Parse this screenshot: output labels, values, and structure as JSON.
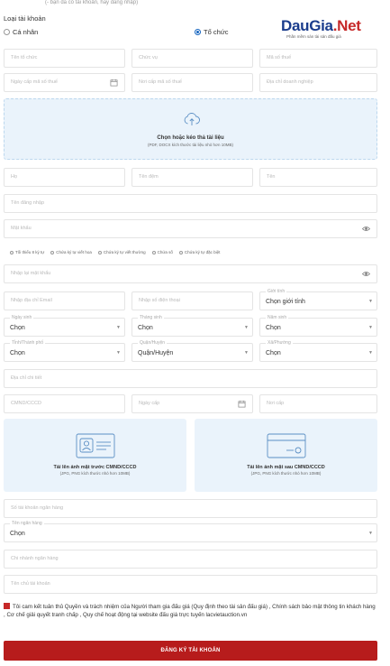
{
  "top_note": "(- bạn đã có tài khoản, hãy đăng nhập)",
  "account_type": {
    "label": "Loại tài khoản",
    "options": [
      "Cá nhân",
      "Tổ chức"
    ],
    "selected": "Tổ chức"
  },
  "logo": {
    "name_main": "DauGia",
    "name_ext": ".Net",
    "tagline": "Phần mềm sàn tài sản đấu giá",
    "colors": {
      "main": "#1a3c8c",
      "ext": "#c62828"
    }
  },
  "org": {
    "org_name": "Tên tổ chức",
    "position": "Chức vụ",
    "tax_code": "Mã số thuế",
    "tax_issue_date": "Ngày cấp mã số thuế",
    "tax_issue_place": "Nơi cấp mã số thuế",
    "business_address": "Địa chỉ doanh nghiệp"
  },
  "upload": {
    "title": "Chọn hoặc kéo thả tài liệu",
    "hint": "(PDF, DOCX kích thước tài liệu nhỏ hơn 10MB)"
  },
  "person": {
    "last_name": "Họ",
    "middle_name": "Tên đệm",
    "first_name": "Tên",
    "username": "Tên đăng nhập",
    "password": "Mật khẩu",
    "confirm_password": "Nhập lại mật khẩu",
    "email": "Nhập địa chỉ Email",
    "phone": "Nhập số điện thoại"
  },
  "password_rules": [
    "Tối thiểu 8 ký tự",
    "Chứa ký tự viết hoa",
    "Chứa ký tự viết thường",
    "Chứa số",
    "Chứa ký tự đặc biệt"
  ],
  "gender": {
    "label": "Giới tính",
    "value": "Chọn giới tính"
  },
  "birth": {
    "day": {
      "label": "Ngày sinh",
      "value": "Chọn"
    },
    "month": {
      "label": "Tháng sinh",
      "value": "Chọn"
    },
    "year": {
      "label": "Năm sinh",
      "value": "Chọn"
    }
  },
  "location": {
    "province": {
      "label": "Tỉnh/Thành phố",
      "value": "Chọn"
    },
    "district": {
      "label": "Quận/Huyện",
      "value": "Quận/Huyện"
    },
    "ward": {
      "label": "Xã/Phường",
      "value": "Chọn"
    }
  },
  "address_detail": "Địa chỉ chi tiết",
  "identity": {
    "number": "CMND/CCCD",
    "issue_date": "Ngày cấp",
    "issue_place": "Nơi cấp"
  },
  "id_front": {
    "title": "Tải lên ảnh mặt trước CMND/CCCD",
    "hint": "(JPG, PNG kích thước nhỏ hơn 10MB)"
  },
  "id_back": {
    "title": "Tải lên ảnh mặt sau CMND/CCCD",
    "hint": "(JPG, PNG kích thước nhỏ hơn 10MB)"
  },
  "bank": {
    "account_number": "Số tài khoản ngân hàng",
    "bank_name": {
      "label": "Tên ngân hàng",
      "value": "Chọn"
    },
    "branch": "Chi nhánh ngân hàng",
    "holder": "Tên chủ tài khoản"
  },
  "terms_text": "Tôi cam kết tuân thủ Quyền và trách nhiệm của Người tham gia đấu giá (Quy định theo tài sản đấu giá) , Chính sách bảo mật thông tin khách hàng , Cơ chế giải quyết tranh chấp , Quy chế hoạt động tại website đấu giá trực tuyến lacvietauction.vn",
  "submit_label": "ĐĂNG KÝ TÀI KHOẢN",
  "colors": {
    "accent": "#1565c0",
    "submit": "#b71c1c",
    "upload_bg": "#eaf3fb"
  }
}
